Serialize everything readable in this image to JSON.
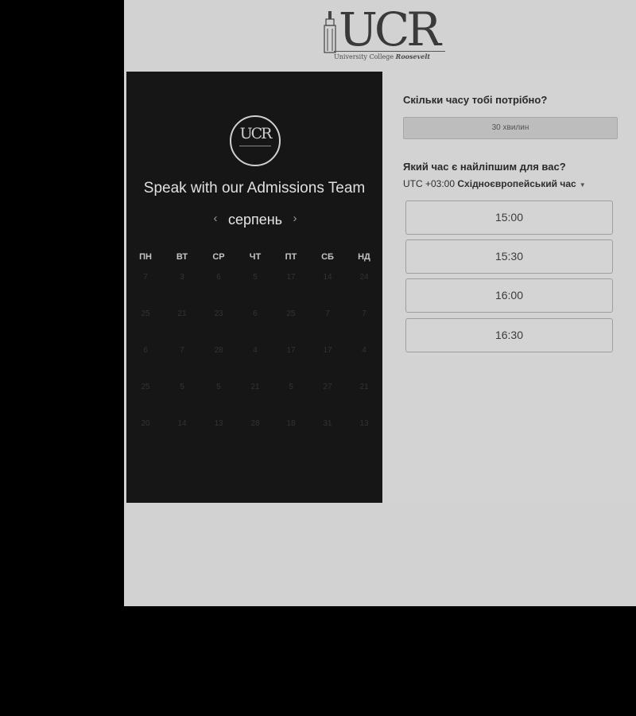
{
  "logo": {
    "name": "UCR",
    "subtitle_a": "University College",
    "subtitle_b": "Roosevelt"
  },
  "left": {
    "badge": "UCR",
    "team": "Speak with our Admissions Team",
    "month": "серпень",
    "weekdays": [
      "ПН",
      "ВТ",
      "СР",
      "ЧТ",
      "ПТ",
      "СБ",
      "НД"
    ],
    "weeks": [
      [
        "7",
        "3",
        "6",
        "5",
        "17",
        "14",
        "24"
      ],
      [
        "25",
        "21",
        "23",
        "6",
        "25",
        "7",
        "7"
      ],
      [
        "6",
        "7",
        "28",
        "4",
        "17",
        "17",
        "4"
      ],
      [
        "25",
        "5",
        "5",
        "21",
        "5",
        "27",
        "21"
      ],
      [
        "20",
        "14",
        "13",
        "28",
        "18",
        "31",
        "13"
      ]
    ]
  },
  "right": {
    "q_duration": "Скільки часу тобі потрібно?",
    "duration": "30 хвилин",
    "q_time": "Який час є найліпшим для вас?",
    "tz_offset": "UTC +03:00",
    "tz_name": "Східноєвропейський час",
    "slots": [
      "15:00",
      "15:30",
      "16:00",
      "16:30"
    ]
  }
}
